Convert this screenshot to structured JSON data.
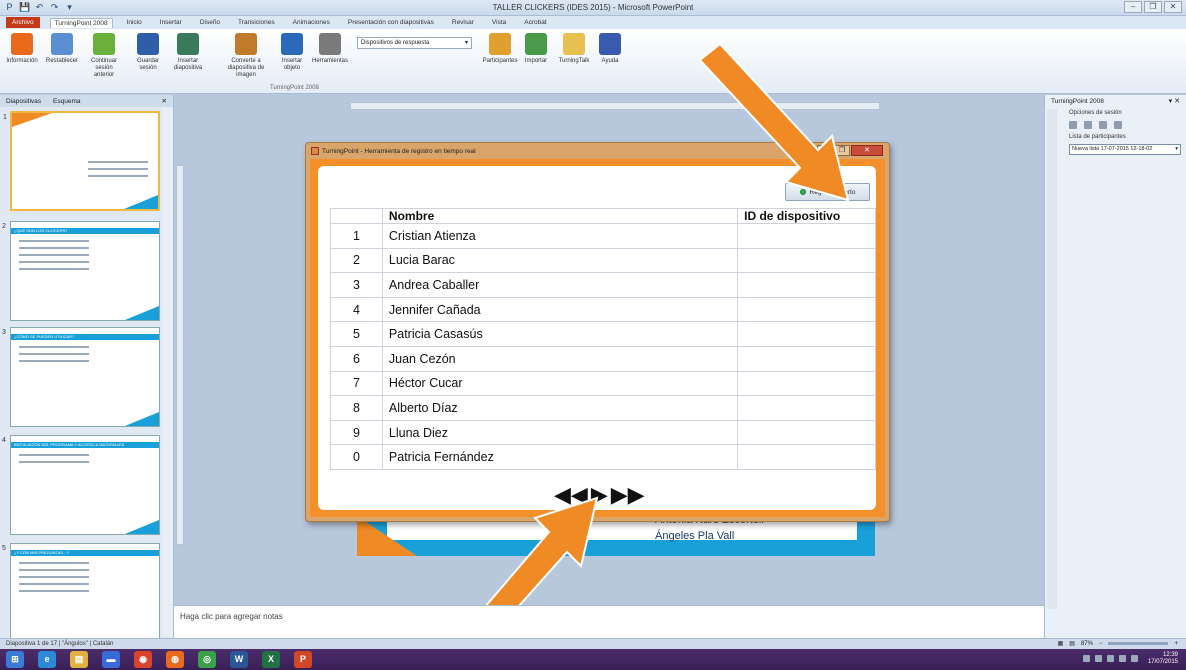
{
  "window": {
    "title": "TALLER CLICKERS (IDES 2015) - Microsoft PowerPoint",
    "qat": [
      "P",
      "💾",
      "↶",
      "↷",
      "▾"
    ],
    "controls": [
      "–",
      "❐",
      "✕"
    ]
  },
  "ribbon_tabs": [
    "Archivo",
    "TurningPoint 2008",
    "Inicio",
    "Insertar",
    "Diseño",
    "Transiciones",
    "Animaciones",
    "Presentación con diapositivas",
    "Revisar",
    "Vista",
    "Acrobat"
  ],
  "ribbon": {
    "buttons": [
      {
        "label": "Información",
        "color": "#e86a1a"
      },
      {
        "label": "Restablecer",
        "color": "#5b8fd4"
      },
      {
        "label": "Continuar sesión anterior",
        "color": "#6ab03a"
      },
      {
        "label": "Guardar sesión",
        "color": "#2f5ea8"
      },
      {
        "label": "Insertar diapositiva",
        "color": "#3a7a5a"
      },
      {
        "label": "Converte a diapositiva de imagen",
        "color": "#c07a2a"
      },
      {
        "label": "Insertar objeto",
        "color": "#2a6ab8"
      },
      {
        "label": "Herramientas",
        "color": "#7a7a7a"
      },
      {
        "label": "Participantes",
        "color": "#e0a030"
      },
      {
        "label": "Importar",
        "color": "#4a9a4a"
      },
      {
        "label": "TurningTalk",
        "color": "#e8c050"
      },
      {
        "label": "Ayuda",
        "color": "#3a5ab0"
      }
    ],
    "response_devices": "Dispositivos de respuesta",
    "group_label": "TurningPoint 2008"
  },
  "left_panel": {
    "tabs": [
      "Diapositivas",
      "Esquema"
    ],
    "close": "✕",
    "slides": [
      {
        "num": "1",
        "header": ""
      },
      {
        "num": "2",
        "header": "¿QUÉ SON LOS CLICKERS?"
      },
      {
        "num": "3",
        "header": "¿CÓMO SE PUEDEN UTILIZAR?"
      },
      {
        "num": "4",
        "header": "INSTALACIÓN DEL PROGRAMA Y ACCESO A MATERIALES"
      },
      {
        "num": "5",
        "header": "¿Y CON MIS PREGUNTAS...?"
      }
    ]
  },
  "dialog": {
    "title": "TurningPoint - Herramienta de registro en tiempo real",
    "registro_button": "Registro abierto",
    "columns": [
      "",
      "Nombre",
      "ID de dispositivo"
    ],
    "rows": [
      {
        "num": "1",
        "name": "Cristian Atienza",
        "id": ""
      },
      {
        "num": "2",
        "name": "Lucia Barac",
        "id": ""
      },
      {
        "num": "3",
        "name": "Andrea Caballer",
        "id": ""
      },
      {
        "num": "4",
        "name": "Jennifer Cañada",
        "id": ""
      },
      {
        "num": "5",
        "name": "Patricia Casasús",
        "id": ""
      },
      {
        "num": "6",
        "name": "Juan Cezón",
        "id": ""
      },
      {
        "num": "7",
        "name": "Héctor Cucar",
        "id": ""
      },
      {
        "num": "8",
        "name": "Alberto Díaz",
        "id": ""
      },
      {
        "num": "9",
        "name": "Lluna Diez",
        "id": ""
      },
      {
        "num": "0",
        "name": "Patricia Fernández",
        "id": ""
      }
    ],
    "pager": {
      "prev": "◀◀",
      "play": "▶",
      "next": "▶▶"
    }
  },
  "slide_behind": {
    "name1": "Antonia Nars Escortell",
    "name2": "Ángeles Pla Vall"
  },
  "notes_placeholder": "Haga clic para agregar notas",
  "right_pane": {
    "title": "TurningPoint 2008",
    "session_options": "Opciones de sesión",
    "participant_list_label": "Lista de participantes",
    "participant_list_value": "Nueva lista 17-07-2015 12-18-02"
  },
  "status_bar": {
    "slide_info": "Diapositiva 1 de 17",
    "theme": "\"Ángulos\"",
    "language": "Catalán",
    "zoom": "87%"
  },
  "taskbar": {
    "apps": [
      {
        "label": "⊞",
        "color": "#3a7ad8"
      },
      {
        "label": "e",
        "color": "#2a8ad8"
      },
      {
        "label": "▤",
        "color": "#e0b040"
      },
      {
        "label": "▬",
        "color": "#3a6ad8"
      },
      {
        "label": "◉",
        "color": "#d8452a"
      },
      {
        "label": "◍",
        "color": "#e86a1a"
      },
      {
        "label": "◎",
        "color": "#3aa04a"
      },
      {
        "label": "W",
        "color": "#2b5797"
      },
      {
        "label": "X",
        "color": "#207245"
      },
      {
        "label": "P",
        "color": "#d24726"
      }
    ],
    "time": "12:39",
    "date": "17/07/2015"
  },
  "colors": {
    "accent_orange": "#f3902a",
    "slide_blue": "#1aa0d8",
    "annotation_arrow": "#f08a24"
  }
}
